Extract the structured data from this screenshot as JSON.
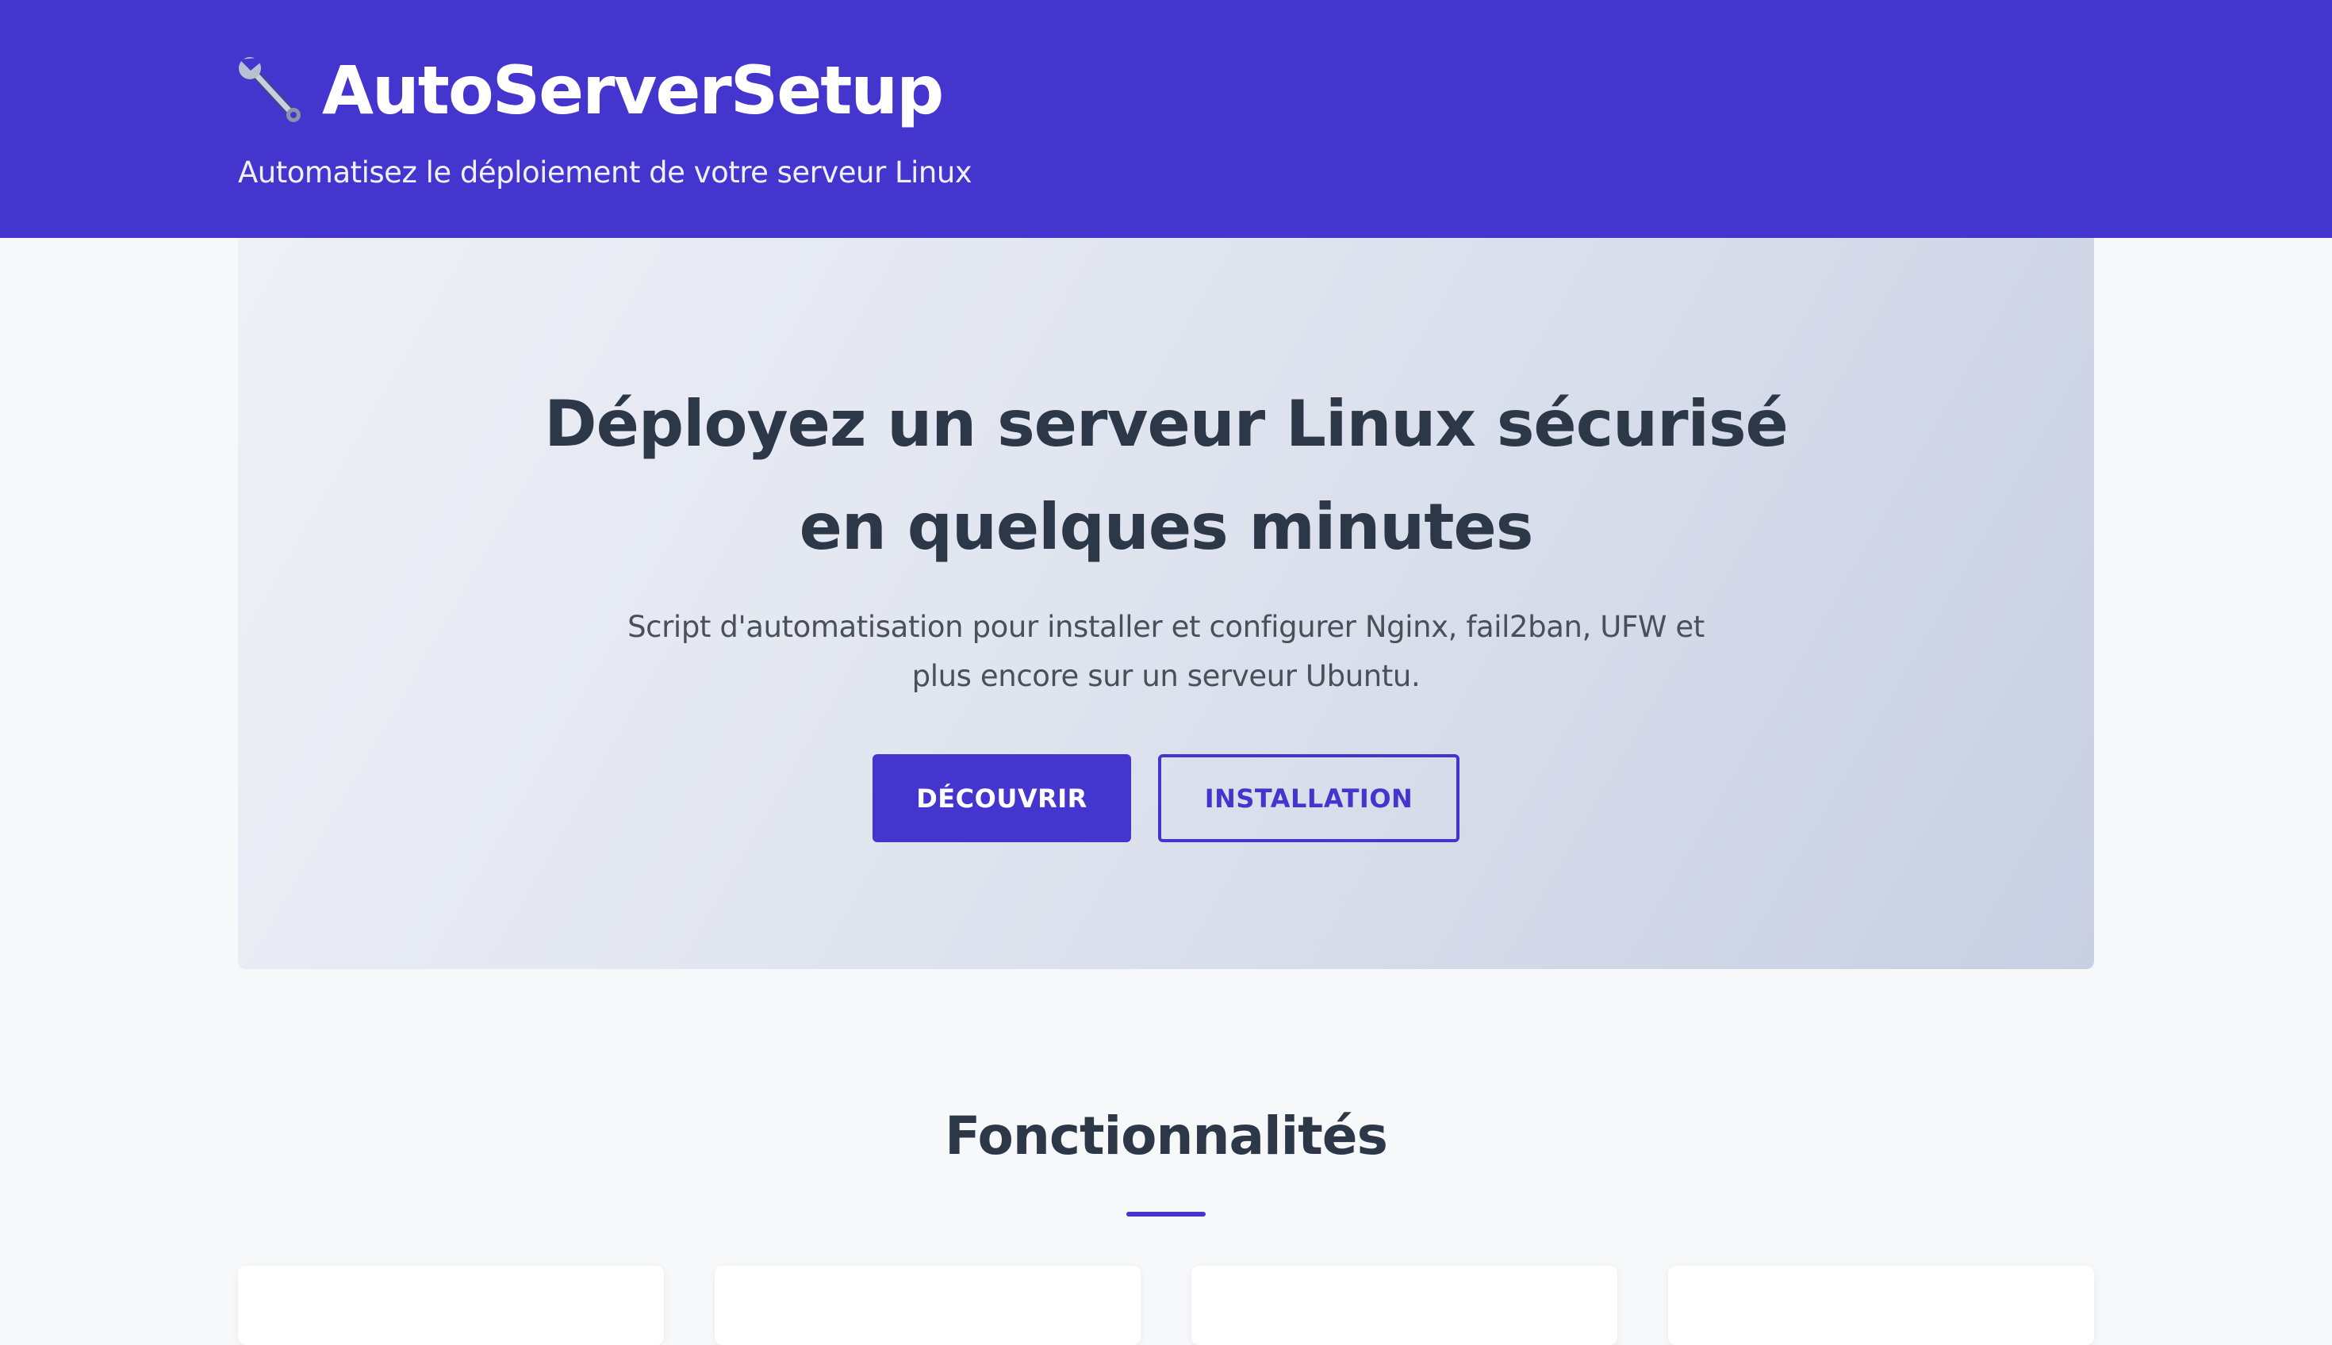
{
  "header": {
    "icon": "wrench-icon",
    "title": "AutoServerSetup",
    "tagline": "Automatisez le déploiement de votre serveur Linux"
  },
  "hero": {
    "title": "Déployez un serveur Linux sécurisé en quelques minutes",
    "subtitle": "Script d'automatisation pour installer et configurer Nginx, fail2ban, UFW et plus encore sur un serveur Ubuntu.",
    "primary_button": "DÉCOUVRIR",
    "secondary_button": "INSTALLATION"
  },
  "features": {
    "title": "Fonctionnalités",
    "card_count_visible": 4
  },
  "colors": {
    "brand": "#4535cf",
    "text_dark": "#2c3748",
    "page_bg": "#f7f8fa"
  }
}
